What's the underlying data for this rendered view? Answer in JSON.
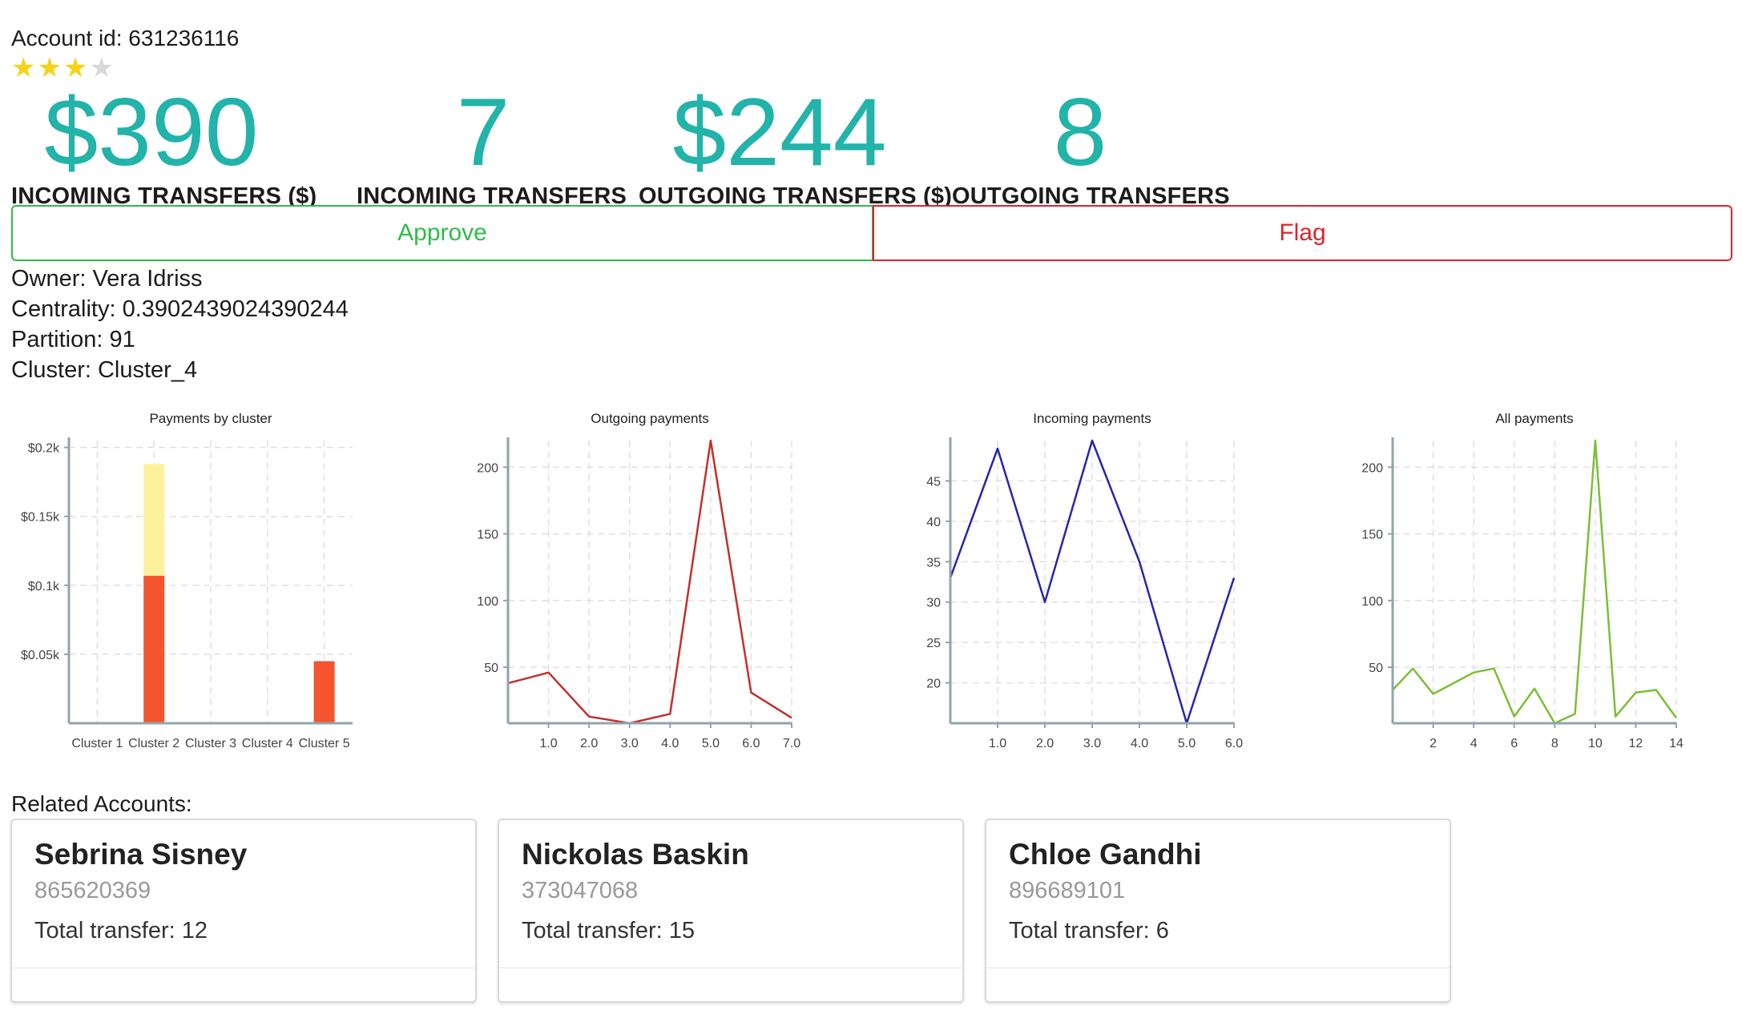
{
  "account": {
    "id_text": "Account id: 631236116",
    "rating": 3,
    "rating_max": 5
  },
  "stats": [
    {
      "value": "$390",
      "label": "INCOMING TRANSFERS ($)"
    },
    {
      "value": "7",
      "label": "INCOMING TRANSFERS"
    },
    {
      "value": "$244",
      "label": "OUTGOING TRANSFERS ($)"
    },
    {
      "value": "8",
      "label": "OUTGOING TRANSFERS"
    }
  ],
  "actions": {
    "approve": "Approve",
    "flag": "Flag"
  },
  "info": {
    "owner": "Owner: Vera Idriss",
    "centrality": "Centrality: 0.3902439024390244",
    "partition": "Partition: 91",
    "cluster": "Cluster: Cluster_4"
  },
  "colors": {
    "accent": "#22b3a9",
    "approve": "#2ebd4a",
    "flag": "#d8262d",
    "bar_outgoing": "#f4552f",
    "bar_incoming": "#fdf19d",
    "outgoing_line": "#c0312b",
    "incoming_line": "#2626a8",
    "all_line": "#7bbf35",
    "star_on": "#f6d21b",
    "star_off": "#d8d8d8"
  },
  "chart_data": [
    {
      "type": "bar",
      "title": "Payments by cluster",
      "categories": [
        "Cluster 1",
        "Cluster 2",
        "Cluster 3",
        "Cluster 4",
        "Cluster 5"
      ],
      "stacked": true,
      "series": [
        {
          "values": [
            0,
            107,
            0,
            0,
            45
          ],
          "color": "#f4552f"
        },
        {
          "values": [
            0,
            81,
            0,
            0,
            0
          ],
          "color": "#fdf19d"
        }
      ],
      "ylim": [
        0,
        205
      ],
      "yticks": [
        50,
        100,
        150,
        200
      ],
      "ytick_labels": [
        "$0.05k",
        "$0.1k",
        "$0.15k",
        "$0.2k"
      ],
      "grid": true
    },
    {
      "type": "line",
      "title": "Outgoing payments",
      "x": [
        0,
        1,
        2,
        3,
        4,
        5,
        6,
        7
      ],
      "y": [
        38,
        46,
        13,
        8,
        15,
        220,
        31,
        12
      ],
      "color": "#c0312b",
      "xlim": [
        0,
        7
      ],
      "ylim": [
        8,
        220
      ],
      "xticks": [
        1,
        2,
        3,
        4,
        5,
        6,
        7
      ],
      "xtick_labels": [
        "1.0",
        "2.0",
        "3.0",
        "4.0",
        "5.0",
        "6.0",
        "7.0"
      ],
      "yticks": [
        50,
        100,
        150,
        200
      ],
      "ytick_labels": [
        "50",
        "100",
        "150",
        "200"
      ],
      "grid": true
    },
    {
      "type": "line",
      "title": "Incoming payments",
      "x": [
        0,
        1,
        2,
        3,
        4,
        5,
        6
      ],
      "y": [
        33,
        49,
        30,
        50,
        35,
        15,
        33
      ],
      "color": "#2626a8",
      "xlim": [
        0,
        6
      ],
      "ylim": [
        15,
        50
      ],
      "xticks": [
        1,
        2,
        3,
        4,
        5,
        6
      ],
      "xtick_labels": [
        "1.0",
        "2.0",
        "3.0",
        "4.0",
        "5.0",
        "6.0"
      ],
      "yticks": [
        20,
        25,
        30,
        35,
        40,
        45
      ],
      "ytick_labels": [
        "20",
        "25",
        "30",
        "35",
        "40",
        "45"
      ],
      "grid": true
    },
    {
      "type": "line",
      "title": "All payments",
      "x": [
        0,
        1,
        2,
        3,
        4,
        5,
        6,
        7,
        8,
        9,
        10,
        11,
        12,
        13,
        14
      ],
      "y": [
        33,
        49,
        30,
        38,
        46,
        49,
        13,
        34,
        8,
        15,
        220,
        13,
        31,
        33,
        12
      ],
      "color": "#7bbf35",
      "xlim": [
        0,
        14
      ],
      "ylim": [
        8,
        220
      ],
      "xticks": [
        2,
        4,
        6,
        8,
        10,
        12,
        14
      ],
      "xtick_labels": [
        "2",
        "4",
        "6",
        "8",
        "10",
        "12",
        "14"
      ],
      "yticks": [
        50,
        100,
        150,
        200
      ],
      "ytick_labels": [
        "50",
        "100",
        "150",
        "200"
      ],
      "grid": true
    }
  ],
  "related": {
    "title": "Related Accounts:",
    "accounts": [
      {
        "name": "Sebrina Sisney",
        "id": "865620369",
        "total": "Total transfer: 12"
      },
      {
        "name": "Nickolas Baskin",
        "id": "373047068",
        "total": "Total transfer: 15"
      },
      {
        "name": "Chloe Gandhi",
        "id": "896689101",
        "total": "Total transfer: 6"
      }
    ]
  }
}
